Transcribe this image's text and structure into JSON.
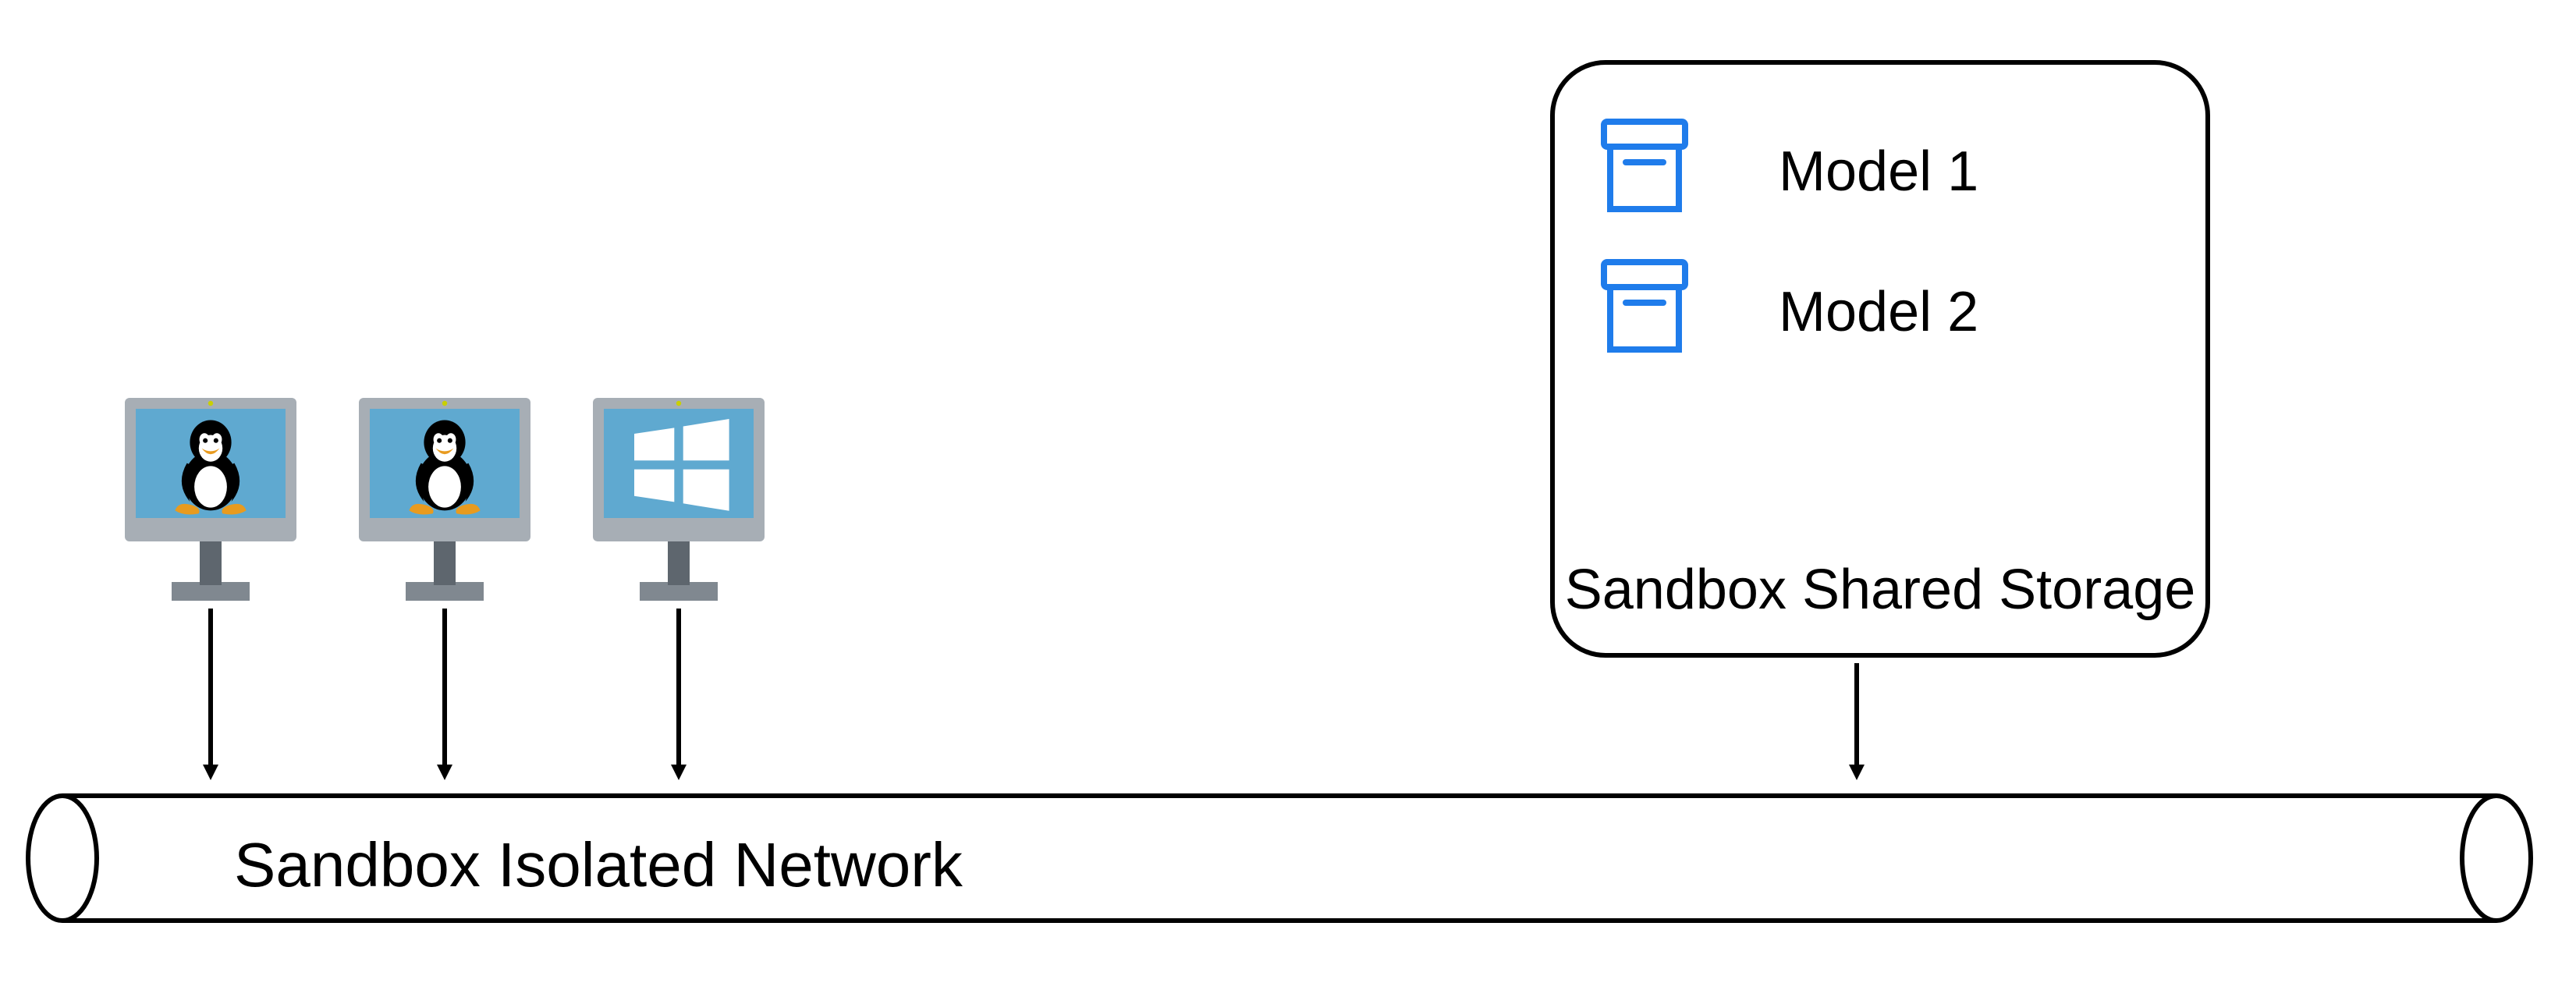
{
  "network": {
    "label": "Sandbox Isolated Network"
  },
  "storage": {
    "title": "Sandbox Shared Storage",
    "items": [
      {
        "label": "Model 1"
      },
      {
        "label": "Model 2"
      }
    ]
  },
  "computers": [
    {
      "os": "linux"
    },
    {
      "os": "linux"
    },
    {
      "os": "windows"
    }
  ],
  "icons": {
    "archive": "archive-icon",
    "linux": "linux-icon",
    "windows": "windows-icon",
    "monitor": "monitor-icon"
  },
  "colors": {
    "monitor_bezel": "#A7AEB5",
    "monitor_stand": "#808890",
    "monitor_screen": "#5FA9D0",
    "windows_logo": "#FFFFFF",
    "archive_stroke": "#1F7CEB",
    "stroke": "#000000"
  }
}
